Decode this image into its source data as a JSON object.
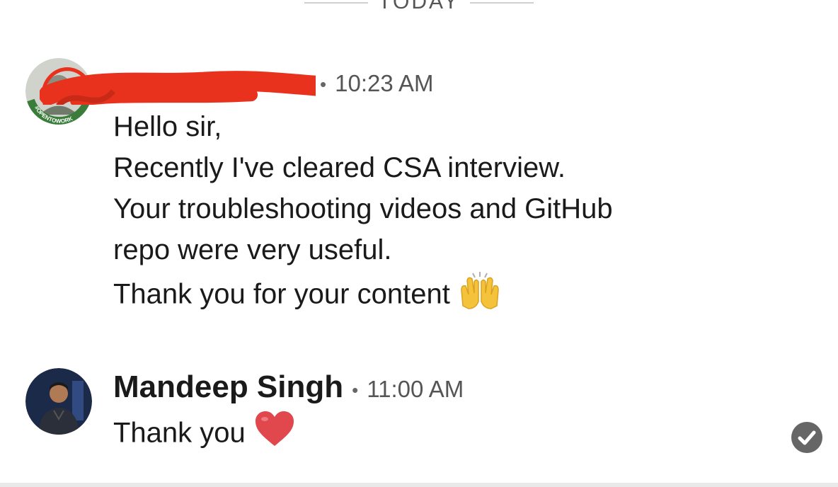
{
  "divider": {
    "label": "TODAY"
  },
  "messages": [
    {
      "sender_name": "",
      "separator": "•",
      "time": "10:23 AM",
      "avatar_badge": "#OPENTOWORK",
      "lines": [
        "Hello sir,",
        "Recently I've cleared CSA interview.",
        "Your troubleshooting videos and GitHub",
        "repo were very useful.",
        "Thank you for your content"
      ],
      "emoji": "raising-hands-emoji"
    },
    {
      "sender_name": "Mandeep Singh",
      "separator": "•",
      "time": "11:00 AM",
      "lines": [
        "Thank you"
      ],
      "emoji": "red-heart-emoji"
    }
  ],
  "status": {
    "icon": "read-check-icon"
  },
  "colors": {
    "accent_green": "#3a7d3a",
    "redaction_red": "#e8321e",
    "heart_red": "#e0484d",
    "emoji_yellow": "#f5c33b"
  }
}
